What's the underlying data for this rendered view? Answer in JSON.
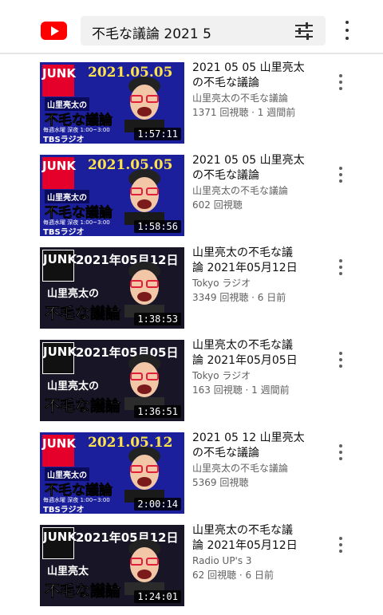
{
  "search": {
    "query": "不毛な議論 2021 5"
  },
  "icons": {
    "logo": "youtube-logo-icon",
    "filter": "filter-sliders-icon",
    "more": "more-vert-icon"
  },
  "colors": {
    "brand": "#ff0000",
    "text": "#0f0f0f",
    "secondary": "#606060",
    "search_bg": "#f1f1f1"
  },
  "results": [
    {
      "title_line1": "2021 05 05 山里亮太",
      "title_line2": "の不毛な議論",
      "channel": "山里亮太の不毛な議論",
      "meta": "1371 回視聴 · 1 週間前",
      "duration": "1:57:11",
      "thumb": {
        "style": "blue",
        "badge": "JUNK",
        "date": "2021.05.05",
        "show_small": "山里亮太の",
        "show_big": "不毛な議論",
        "schedule": "毎週水曜 深夜 1:00~3:00",
        "station": "TBSラジオ"
      }
    },
    {
      "title_line1": "2021 05 05 山里亮太",
      "title_line2": "の不毛な議論",
      "channel": "山里亮太の不毛な議論",
      "meta": "602 回視聴",
      "duration": "1:58:56",
      "thumb": {
        "style": "blue",
        "badge": "JUNK",
        "date": "2021.05.05",
        "show_small": "山里亮太の",
        "show_big": "不毛な議論",
        "schedule": "毎週水曜 深夜 1:00~3:00",
        "station": "TBSラジオ"
      }
    },
    {
      "title_line1": "山里亮太の不毛な議",
      "title_line2": "論 2021年05月12日",
      "channel": "Tokyo ラジオ",
      "meta": "3349 回視聴 · 6 日前",
      "duration": "1:38:53",
      "thumb": {
        "style": "dark",
        "badge": "JUNK",
        "date": "2021年05月12日",
        "show_small": "山里亮太の",
        "show_big": "不毛な議論",
        "schedule": "",
        "station": ""
      }
    },
    {
      "title_line1": "山里亮太の不毛な議",
      "title_line2": "論 2021年05月05日",
      "channel": "Tokyo ラジオ",
      "meta": "163 回視聴 · 1 週間前",
      "duration": "1:36:51",
      "thumb": {
        "style": "dark",
        "badge": "JUNK",
        "date": "2021年05月05日",
        "show_small": "山里亮太の",
        "show_big": "不毛な議論",
        "schedule": "",
        "station": ""
      }
    },
    {
      "title_line1": "2021 05 12 山里亮太",
      "title_line2": "の不毛な議論",
      "channel": "山里亮太の不毛な議論",
      "meta": "5369 回視聴",
      "duration": "2:00:14",
      "thumb": {
        "style": "blue",
        "badge": "JUNK",
        "date": "2021.05.12",
        "show_small": "山里亮太の",
        "show_big": "不毛な議論",
        "schedule": "毎週水曜 深夜 1:00~3:00",
        "station": "TBSラジオ"
      }
    },
    {
      "title_line1": "山里亮太の不毛な議",
      "title_line2": "論 2021年05月12日",
      "channel": "Radio UP's 3",
      "meta": "62 回視聴 · 6 日前",
      "duration": "1:24:01",
      "thumb": {
        "style": "dark",
        "badge": "JUNK",
        "date": "2021年05月12日",
        "show_small": "山里亮太",
        "show_big": "不毛な議論",
        "schedule": "",
        "station": ""
      }
    }
  ]
}
